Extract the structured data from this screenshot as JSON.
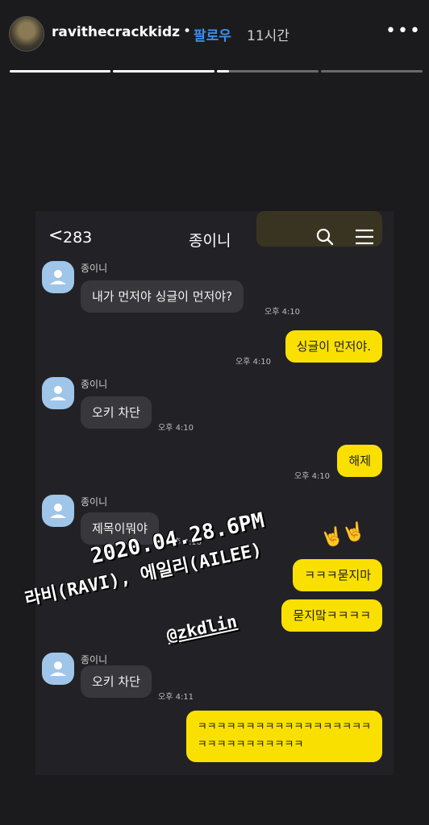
{
  "story": {
    "username": "ravithecrackkidz",
    "separator": "•",
    "follow_label": "팔로우",
    "time_ago": "11시간",
    "more_label": "•••",
    "progress": [
      1,
      1,
      0.12,
      0
    ]
  },
  "chat": {
    "back_label": "<",
    "count": "283",
    "title": "종이니",
    "ghost_text": "",
    "messages": [
      {
        "dir": "in",
        "name": "종이니",
        "text": "내가 먼저야 싱글이 먼저야?",
        "time": "오후 4:10"
      },
      {
        "dir": "out",
        "text": "싱글이 먼저야.",
        "time": "오후 4:10"
      },
      {
        "dir": "in",
        "name": "종이니",
        "text": "오키 차단",
        "time": "오후 4:10"
      },
      {
        "dir": "out",
        "text": "해제",
        "time": "오후 4:10"
      },
      {
        "dir": "in",
        "name": "종이니",
        "text": "제목이뭐야",
        "time": "오후 4:10"
      },
      {
        "dir": "out",
        "text": "ㅋㅋㅋ묻지마",
        "time": ""
      },
      {
        "dir": "out",
        "text": "묻지맠ㅋㅋㅋㅋ",
        "time": ""
      },
      {
        "dir": "in",
        "name": "종이니",
        "text": "오키 차단",
        "time": "오후 4:11"
      },
      {
        "dir": "out",
        "text": "ㅋㅋㅋㅋㅋㅋㅋㅋㅋㅋㅋㅋㅋㅋㅋㅋㅋㅋ",
        "text2": "ㅋㅋㅋㅋㅋㅋㅋㅋㅋㅋㅋ",
        "time": ""
      }
    ]
  },
  "overlay": {
    "date": "2020.04.28.6PM",
    "names": "라비(RAVI), 에일리(AILEE)",
    "mention": "@zkdlin",
    "emoji": "🤘🤘"
  },
  "colors": {
    "follow": "#3a8ef0",
    "my_bubble": "#f9e000",
    "their_bubble": "#38383c",
    "profile_bg": "#9fc6e8"
  }
}
